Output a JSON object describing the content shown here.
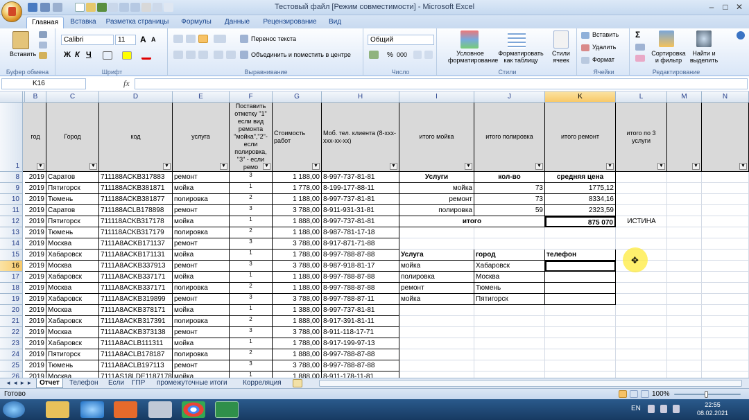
{
  "window": {
    "title": "Тестовый файл  [Режим совместимости] - Microsoft Excel",
    "minimize": "–",
    "maximize": "□",
    "close": "✕"
  },
  "ribbon_tabs": [
    "Главная",
    "Вставка",
    "Разметка страницы",
    "Формулы",
    "Данные",
    "Рецензирование",
    "Вид"
  ],
  "ribbon": {
    "clipboard": {
      "paste": "Вставить",
      "label": "Буфер обмена"
    },
    "font": {
      "name": "Calibri",
      "size": "11",
      "bold": "Ж",
      "italic": "К",
      "underline": "Ч",
      "grow": "A",
      "shrink": "A",
      "label": "Шрифт"
    },
    "alignment": {
      "wrap": "Перенос текста",
      "merge": "Объединить и поместить в центре",
      "label": "Выравнивание"
    },
    "number": {
      "format": "Общий",
      "percent": "%",
      "thousands": "000",
      "dec_inc": ",0",
      ".dec_dec": ",00",
      "label": "Число"
    },
    "styles": {
      "conditional": "Условное форматирование",
      "as_table": "Форматировать как таблицу",
      "cell_styles": "Стили ячеек",
      "label": "Стили"
    },
    "cells": {
      "insert": "Вставить",
      "delete": "Удалить",
      "format": "Формат",
      "label": "Ячейки"
    },
    "editing": {
      "sum": "Σ",
      "sort": "Сортировка и фильтр",
      "find": "Найти и выделить",
      "label": "Редактирование"
    }
  },
  "formula_bar": {
    "name_box": "K16",
    "fx": "fx",
    "value": ""
  },
  "columns": [
    {
      "id": "A",
      "label": ""
    },
    {
      "id": "B",
      "label": "B"
    },
    {
      "id": "C",
      "label": "C"
    },
    {
      "id": "D",
      "label": "D"
    },
    {
      "id": "E",
      "label": "E"
    },
    {
      "id": "F",
      "label": "F"
    },
    {
      "id": "G",
      "label": "G"
    },
    {
      "id": "H",
      "label": "H"
    },
    {
      "id": "I",
      "label": "I"
    },
    {
      "id": "J",
      "label": "J"
    },
    {
      "id": "K",
      "label": "K"
    },
    {
      "id": "L",
      "label": "L"
    },
    {
      "id": "M",
      "label": "M"
    },
    {
      "id": "N",
      "label": "N"
    }
  ],
  "header_row": {
    "row": "1",
    "cells": [
      "год",
      "Город",
      "код",
      "услуга",
      "Поставить отметку \"1\" если вид ремонта \"мойка\",\"2\"- если полировка, \"3\" - если ремо",
      "Стоимость работ",
      "Моб. тел. клиента (8-xxx-xxx-xx-xx)",
      "итого мойка",
      "итого полировка",
      "итого ремонт",
      "итого по 3 услуги",
      "",
      ""
    ]
  },
  "rows": [
    {
      "n": "8",
      "year": "2019",
      "city": "Саратов",
      "code": "711188ACKB317883",
      "service": "ремонт",
      "mark": "3",
      "cost": "1 188,00",
      "phone": "8-997-737-81-81"
    },
    {
      "n": "9",
      "year": "2019",
      "city": "Пятигорск",
      "code": "711188ACKB381871",
      "service": "мойка",
      "mark": "1",
      "cost": "1 778,00",
      "phone": "8-199-177-88-11"
    },
    {
      "n": "10",
      "year": "2019",
      "city": "Тюмень",
      "code": "711188ACKB381877",
      "service": "полировка",
      "mark": "2",
      "cost": "1 188,00",
      "phone": "8-997-737-81-81"
    },
    {
      "n": "11",
      "year": "2019",
      "city": "Саратов",
      "code": "711188ACLB178898",
      "service": "ремонт",
      "mark": "3",
      "cost": "3 788,00",
      "phone": "8-911-931-31-81"
    },
    {
      "n": "12",
      "year": "2019",
      "city": "Пятигорск",
      "code": "711118ACKB317178",
      "service": "мойка",
      "mark": "1",
      "cost": "1 888,00",
      "phone": "8-997-737-81-81"
    },
    {
      "n": "13",
      "year": "2019",
      "city": "Тюмень",
      "code": "711118ACKB317179",
      "service": "полировка",
      "mark": "2",
      "cost": "1 188,00",
      "phone": "8-987-781-17-18"
    },
    {
      "n": "14",
      "year": "2019",
      "city": "Москва",
      "code": "7111A8ACKB171137",
      "service": "ремонт",
      "mark": "3",
      "cost": "3 788,00",
      "phone": "8-917-871-71-88"
    },
    {
      "n": "15",
      "year": "2019",
      "city": "Хабаровск",
      "code": "7111A8ACKB171131",
      "service": "мойка",
      "mark": "1",
      "cost": "1 788,00",
      "phone": "8-997-788-87-88"
    },
    {
      "n": "16",
      "year": "2019",
      "city": "Москва",
      "code": "7111A8ACKB337913",
      "service": "ремонт",
      "mark": "3",
      "cost": "3 788,00",
      "phone": "8-987-918-81-17"
    },
    {
      "n": "17",
      "year": "2019",
      "city": "Хабаровск",
      "code": "7111A8ACKB337171",
      "service": "мойка",
      "mark": "1",
      "cost": "1 188,00",
      "phone": "8-997-788-87-88"
    },
    {
      "n": "18",
      "year": "2019",
      "city": "Москва",
      "code": "7111A8ACKB337171",
      "service": "полировка",
      "mark": "2",
      "cost": "1 188,00",
      "phone": "8-997-788-87-88"
    },
    {
      "n": "19",
      "year": "2019",
      "city": "Хабаровск",
      "code": "7111A8ACKB319899",
      "service": "ремонт",
      "mark": "3",
      "cost": "3 788,00",
      "phone": "8-997-788-87-11"
    },
    {
      "n": "20",
      "year": "2019",
      "city": "Москва",
      "code": "7111A8ACKB378171",
      "service": "мойка",
      "mark": "1",
      "cost": "1 388,00",
      "phone": "8-997-737-81-81"
    },
    {
      "n": "21",
      "year": "2019",
      "city": "Хабаровск",
      "code": "7111A8ACKB317391",
      "service": "полировка",
      "mark": "2",
      "cost": "1 888,00",
      "phone": "8-917-391-81-11"
    },
    {
      "n": "22",
      "year": "2019",
      "city": "Москва",
      "code": "7111A8ACKB373138",
      "service": "ремонт",
      "mark": "3",
      "cost": "3 788,00",
      "phone": "8-911-118-17-71"
    },
    {
      "n": "23",
      "year": "2019",
      "city": "Хабаровск",
      "code": "7111A8ACLB111311",
      "service": "мойка",
      "mark": "1",
      "cost": "1 788,00",
      "phone": "8-917-199-97-13"
    },
    {
      "n": "24",
      "year": "2019",
      "city": "Пятигорск",
      "code": "7111A8ACLB178187",
      "service": "полировка",
      "mark": "2",
      "cost": "1 888,00",
      "phone": "8-997-788-87-88"
    },
    {
      "n": "25",
      "year": "2019",
      "city": "Тюмень",
      "code": "7111A8ACLB197113",
      "service": "ремонт",
      "mark": "3",
      "cost": "3 788,00",
      "phone": "8-997-788-87-88"
    },
    {
      "n": "26",
      "year": "2019",
      "city": "Москва",
      "code": "7111AS18LDE1187178",
      "service": "мойка",
      "mark": "1",
      "cost": "1 888,00",
      "phone": "8-911-178-11-81"
    }
  ],
  "summary_table": {
    "headers": [
      "Услуги",
      "кол-во",
      "средняя цена"
    ],
    "rows": [
      [
        "мойка",
        "73",
        "1775,12"
      ],
      [
        "ремонт",
        "73",
        "8334,16"
      ],
      [
        "полировка",
        "59",
        "2323,59"
      ]
    ],
    "total_label": "итого",
    "total_value": "875 070",
    "check": "ИСТИНА"
  },
  "lookup_table": {
    "headers": [
      "Услуга",
      "город",
      "телефон"
    ],
    "rows": [
      [
        "мойка",
        "Хабаровск",
        ""
      ],
      [
        "полировка",
        "Москва",
        ""
      ],
      [
        "ремонт",
        "Тюмень",
        ""
      ],
      [
        "мойка",
        "Пятигорск",
        ""
      ]
    ]
  },
  "sheet_tabs": [
    "Отчет",
    "Телефон",
    "Если",
    "ГПР",
    "промежуточные итоги",
    "Корреляция"
  ],
  "status": {
    "ready": "Готово",
    "zoom": "100%"
  },
  "taskbar": {
    "lang": "EN",
    "time": "22:55",
    "date": "08.02.2021"
  }
}
